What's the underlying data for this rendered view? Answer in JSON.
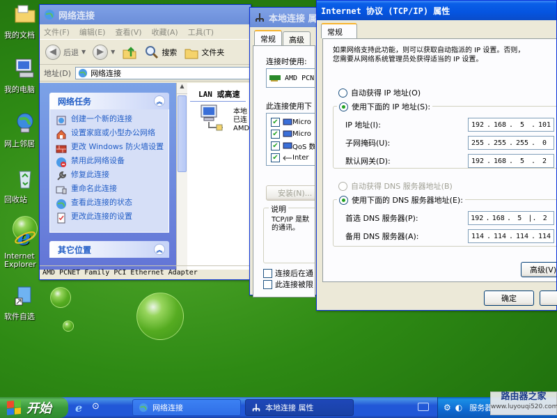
{
  "desktop": {
    "icons": [
      {
        "label": "我的文档"
      },
      {
        "label": "我的电脑"
      },
      {
        "label": "网上邻居"
      },
      {
        "label": "回收站"
      },
      {
        "label": "Internet Explorer"
      },
      {
        "label": "软件自选"
      }
    ]
  },
  "explorer": {
    "title": "网络连接",
    "menu": [
      "文件(F)",
      "编辑(E)",
      "查看(V)",
      "收藏(A)",
      "工具(T)"
    ],
    "toolbar": {
      "back": "后退",
      "search": "搜索",
      "folders": "文件夹"
    },
    "address": {
      "label": "地址(D)",
      "value": "网络连接"
    },
    "tasks": {
      "title": "网络任务",
      "items": [
        "创建一个新的连接",
        "设置家庭或小型办公网络",
        "更改 Windows 防火墙设置",
        "禁用此网络设备",
        "修复此连接",
        "重命名此连接",
        "查看此连接的状态",
        "更改此连接的设置"
      ]
    },
    "other_places": {
      "title": "其它位置"
    },
    "content": {
      "group_header": "LAN 或高速",
      "item_lines": [
        "本地",
        "已连",
        "AMD"
      ]
    },
    "status": "AMD PCNET Family PCI Ethernet Adapter"
  },
  "localconn": {
    "title": "本地连接 属",
    "tabs": [
      "常规",
      "高级"
    ],
    "connect_using": "连接时使用:",
    "adapter": "AMD PCN",
    "items_label": "此连接使用下",
    "items": [
      "Micro",
      "Micro",
      "QoS 数",
      "Inter"
    ],
    "install_button": "安装(N)...",
    "description_label": "说明",
    "description": "TCP/IP 是默认的广域网协议，它提供跨越多种互联网络的通讯。",
    "description_visible": [
      "TCP/IP 是默",
      "的通讯。"
    ],
    "options": [
      "连接后在通",
      "此连接被限"
    ]
  },
  "tcpip": {
    "title": "Internet 协议 (TCP/IP) 属性",
    "tab": "常规",
    "intro_lines": [
      "如果网络支持此功能，则可以获取自动指派的 IP 设置。否则，",
      "您需要从网络系统管理员处获得适当的 IP 设置。"
    ],
    "auto_ip": "自动获得 IP 地址(O)",
    "use_ip": "使用下面的 IP 地址(S):",
    "ip_label": "IP 地址(I):",
    "ip": [
      "192",
      "168",
      "5",
      "101"
    ],
    "mask_label": "子网掩码(U):",
    "mask": [
      "255",
      "255",
      "255",
      "0"
    ],
    "gateway_label": "默认网关(D):",
    "gateway": [
      "192",
      "168",
      "5",
      "2"
    ],
    "auto_dns": "自动获得 DNS 服务器地址(B)",
    "use_dns": "使用下面的 DNS 服务器地址(E):",
    "dns1_label": "首选 DNS 服务器(P):",
    "dns1": [
      "192",
      "168",
      "5",
      "2"
    ],
    "dns2_label": "备用 DNS 服务器(A):",
    "dns2": [
      "114",
      "114",
      "114",
      "114"
    ],
    "advanced_button": "高级(V)",
    "ok_button": "确定"
  },
  "taskbar": {
    "start": "开始",
    "tasks": [
      "网络连接",
      "本地连接 属性"
    ],
    "tray_text": "服务器",
    "watermark_title": "路由器之家",
    "watermark_url": "www.luyouqi520.com"
  },
  "colors": {
    "titlebar": "#0554e0",
    "taskbar": "#2157d7",
    "start": "#3a9a3a",
    "link": "#215dc6"
  }
}
